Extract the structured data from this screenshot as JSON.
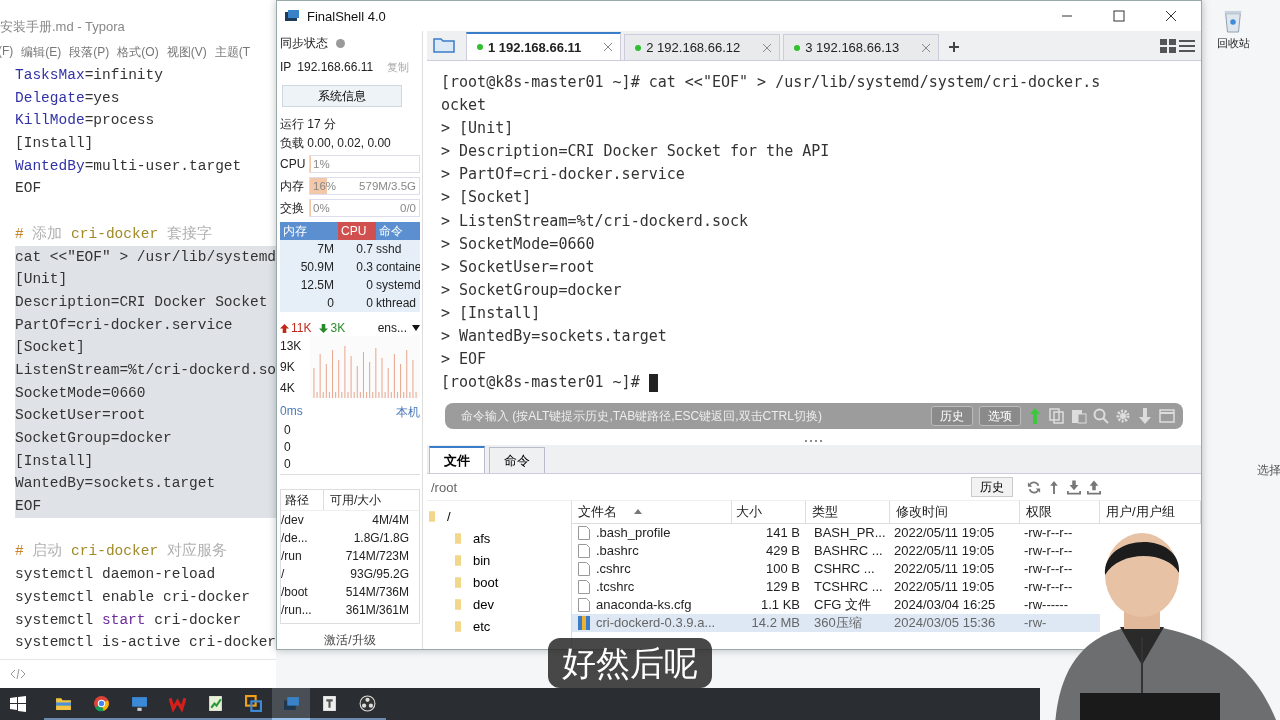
{
  "desktop": {
    "recycle_bin": "回收站",
    "side_text": "选择"
  },
  "editor": {
    "title": "安装手册.md - Typora",
    "menu": [
      "(F)",
      "编辑(E)",
      "段落(P)",
      "格式(O)",
      "视图(V)",
      "主题(T"
    ],
    "lines": [
      {
        "kind": "code",
        "selected": false,
        "segments": [
          {
            "kind": "key",
            "text": "TasksMax"
          },
          {
            "kind": "plain",
            "text": "=infinity"
          }
        ]
      },
      {
        "kind": "code",
        "selected": false,
        "segments": [
          {
            "kind": "key",
            "text": "Delegate"
          },
          {
            "kind": "plain",
            "text": "=yes"
          }
        ]
      },
      {
        "kind": "code",
        "selected": false,
        "segments": [
          {
            "kind": "key",
            "text": "KillMode"
          },
          {
            "kind": "plain",
            "text": "=process"
          }
        ]
      },
      {
        "kind": "code",
        "selected": false,
        "segments": [
          {
            "kind": "plain",
            "text": "[Install]"
          }
        ]
      },
      {
        "kind": "code",
        "selected": false,
        "segments": [
          {
            "kind": "key",
            "text": "WantedBy"
          },
          {
            "kind": "plain",
            "text": "=multi-user.target"
          }
        ]
      },
      {
        "kind": "code",
        "selected": false,
        "segments": [
          {
            "kind": "plain",
            "text": "EOF"
          }
        ]
      },
      {
        "kind": "blank"
      },
      {
        "kind": "code",
        "selected": false,
        "segments": [
          {
            "kind": "hash",
            "text": "# "
          },
          {
            "kind": "hint",
            "text": "添加 "
          },
          {
            "kind": "term",
            "text": "cri-docker"
          },
          {
            "kind": "hint",
            "text": " 套接字"
          }
        ]
      },
      {
        "kind": "code",
        "selected": true,
        "segments": [
          {
            "kind": "plain",
            "text": "cat <<\"EOF\" > /usr/lib/systemd"
          }
        ]
      },
      {
        "kind": "code",
        "selected": true,
        "segments": [
          {
            "kind": "plain",
            "text": "[Unit]"
          }
        ]
      },
      {
        "kind": "code",
        "selected": true,
        "segments": [
          {
            "kind": "plain",
            "text": "Description=CRI Docker Socket"
          }
        ]
      },
      {
        "kind": "code",
        "selected": true,
        "segments": [
          {
            "kind": "plain",
            "text": "PartOf=cri-docker.service"
          }
        ]
      },
      {
        "kind": "code",
        "selected": true,
        "segments": [
          {
            "kind": "plain",
            "text": "[Socket]"
          }
        ]
      },
      {
        "kind": "code",
        "selected": true,
        "segments": [
          {
            "kind": "plain",
            "text": "ListenStream=%t/cri-dockerd.so"
          }
        ]
      },
      {
        "kind": "code",
        "selected": true,
        "segments": [
          {
            "kind": "plain",
            "text": "SocketMode=0660"
          }
        ]
      },
      {
        "kind": "code",
        "selected": true,
        "segments": [
          {
            "kind": "plain",
            "text": "SocketUser=root"
          }
        ]
      },
      {
        "kind": "code",
        "selected": true,
        "segments": [
          {
            "kind": "plain",
            "text": "SocketGroup=docker"
          }
        ]
      },
      {
        "kind": "code",
        "selected": true,
        "segments": [
          {
            "kind": "plain",
            "text": "[Install]"
          }
        ]
      },
      {
        "kind": "code",
        "selected": true,
        "segments": [
          {
            "kind": "plain",
            "text": "WantedBy=sockets.target"
          }
        ]
      },
      {
        "kind": "code",
        "selected": true,
        "segments": [
          {
            "kind": "plain",
            "text": "EOF"
          }
        ]
      },
      {
        "kind": "blank"
      },
      {
        "kind": "code",
        "selected": false,
        "segments": [
          {
            "kind": "hash",
            "text": "# "
          },
          {
            "kind": "hint",
            "text": "启动 "
          },
          {
            "kind": "term",
            "text": "cri-docker"
          },
          {
            "kind": "hint",
            "text": " 对应服务"
          }
        ]
      },
      {
        "kind": "code",
        "selected": false,
        "segments": [
          {
            "kind": "plain",
            "text": "systemctl daemon-reload"
          }
        ]
      },
      {
        "kind": "code",
        "selected": false,
        "segments": [
          {
            "kind": "plain",
            "text": "systemctl enable cri-docker"
          }
        ]
      },
      {
        "kind": "code",
        "selected": false,
        "segments": [
          {
            "kind": "plain",
            "text": "systemctl "
          },
          {
            "kind": "keyword",
            "text": "start"
          },
          {
            "kind": "plain",
            "text": " cri-docker"
          }
        ]
      },
      {
        "kind": "code",
        "selected": false,
        "segments": [
          {
            "kind": "plain",
            "text": "systemctl is-active cri-docker"
          }
        ]
      }
    ]
  },
  "finalshell": {
    "title": "FinalShell 4.0",
    "sidebar": {
      "sync_label": "同步状态",
      "sync_on": false,
      "ip_label": "IP",
      "ip": "192.168.66.11",
      "copy_link": "复制",
      "sysinfo_button": "系统信息",
      "uptime": "运行 17 分",
      "load": "负载 0.00, 0.02, 0.00",
      "meters": [
        {
          "label": "CPU",
          "value": "1%",
          "level": 0.01
        },
        {
          "label": "内存",
          "value": "16%",
          "detail": "579M/3.5G",
          "level": 0.16
        },
        {
          "label": "交换",
          "value": "0%",
          "detail": "0/0",
          "level": 0
        }
      ],
      "process_columns": [
        {
          "label": "内存",
          "selected": false
        },
        {
          "label": "CPU",
          "selected": true
        },
        {
          "label": "命令",
          "selected": false
        }
      ],
      "processes": [
        {
          "mem": "7M",
          "cpu": "0.7",
          "cmd": "sshd"
        },
        {
          "mem": "50.9M",
          "cpu": "0.3",
          "cmd": "containe"
        },
        {
          "mem": "12.5M",
          "cpu": "0",
          "cmd": "systemd"
        },
        {
          "mem": "0",
          "cpu": "0",
          "cmd": "kthread"
        }
      ],
      "net": {
        "up": "11K",
        "down": "3K",
        "iface": "ens...",
        "ticks": [
          "13K",
          "9K",
          "4K"
        ]
      },
      "latency": {
        "label": "0ms",
        "host": "本机",
        "values": [
          "0",
          "0",
          "0"
        ]
      },
      "disk_columns": [
        "路径",
        "可用/大小"
      ],
      "disks": [
        {
          "path": "/dev",
          "size": "4M/4M"
        },
        {
          "path": "/de...",
          "size": "1.8G/1.8G"
        },
        {
          "path": "/run",
          "size": "714M/723M"
        },
        {
          "path": "/",
          "size": "93G/95.2G"
        },
        {
          "path": "/boot",
          "size": "514M/736M"
        },
        {
          "path": "/run...",
          "size": "361M/361M"
        }
      ],
      "activate_link": "激活/升级"
    },
    "tabs": [
      {
        "label": "1 192.168.66.11",
        "selected": true
      },
      {
        "label": "2 192.168.66.12",
        "selected": false
      },
      {
        "label": "3 192.168.66.13",
        "selected": false
      }
    ],
    "terminal": [
      "[root@k8s-master01 ~]# cat <<\"EOF\" > /usr/lib/systemd/system/cri-docker.s",
      "ocket",
      "> [Unit]",
      "> Description=CRI Docker Socket for the API",
      "> PartOf=cri-docker.service",
      "> [Socket]",
      "> ListenStream=%t/cri-dockerd.sock",
      "> SocketMode=0660",
      "> SocketUser=root",
      "> SocketGroup=docker",
      "> [Install]",
      "> WantedBy=sockets.target",
      "> EOF",
      "[root@k8s-master01 ~]# "
    ],
    "command_bar": {
      "placeholder": "命令输入 (按ALT键提示历史,TAB键路径,ESC键返回,双击CTRL切换)",
      "buttons": [
        "历史",
        "选项"
      ]
    },
    "bottom_tabs": [
      {
        "label": "文件",
        "selected": true
      },
      {
        "label": "命令",
        "selected": false
      }
    ],
    "path": "/root",
    "history_button": "历史",
    "tree": [
      "/",
      "afs",
      "bin",
      "boot",
      "dev",
      "etc"
    ],
    "file_columns": [
      "文件名",
      "大小",
      "类型",
      "修改时间",
      "权限",
      "用户/用户组"
    ],
    "files": [
      {
        "kind": "file",
        "name": ".bash_profile",
        "size": "141 B",
        "type": "BASH_PR...",
        "modified": "2022/05/11 19:05",
        "perms": "-rw-r--r--",
        "selected": false
      },
      {
        "kind": "file",
        "name": ".bashrc",
        "size": "429 B",
        "type": "BASHRC ...",
        "modified": "2022/05/11 19:05",
        "perms": "-rw-r--r--",
        "selected": false
      },
      {
        "kind": "file",
        "name": ".cshrc",
        "size": "100 B",
        "type": "CSHRC ...",
        "modified": "2022/05/11 19:05",
        "perms": "-rw-r--r--",
        "selected": false
      },
      {
        "kind": "file",
        "name": ".tcshrc",
        "size": "129 B",
        "type": "TCSHRC ...",
        "modified": "2022/05/11 19:05",
        "perms": "-rw-r--r--",
        "selected": false
      },
      {
        "kind": "file",
        "name": "anaconda-ks.cfg",
        "size": "1.1 KB",
        "type": "CFG 文件",
        "modified": "2024/03/04 16:25",
        "perms": "-rw------",
        "selected": false
      },
      {
        "kind": "archive",
        "name": "cri-dockerd-0.3.9.a...",
        "size": "14.2 MB",
        "type": "360压缩",
        "modified": "2024/03/05 15:36",
        "perms": "-rw-",
        "selected": true
      }
    ]
  },
  "subtitle": "好然后呢",
  "taskbar": [
    {
      "kind": "explorer",
      "active": false
    },
    {
      "kind": "chrome",
      "active": false
    },
    {
      "kind": "monitor",
      "active": false
    },
    {
      "kind": "wps",
      "active": false
    },
    {
      "kind": "chart",
      "active": false
    },
    {
      "kind": "vm",
      "active": false
    },
    {
      "kind": "finalshell",
      "active": true
    },
    {
      "kind": "typora",
      "active": false
    },
    {
      "kind": "obs",
      "active": false
    }
  ]
}
